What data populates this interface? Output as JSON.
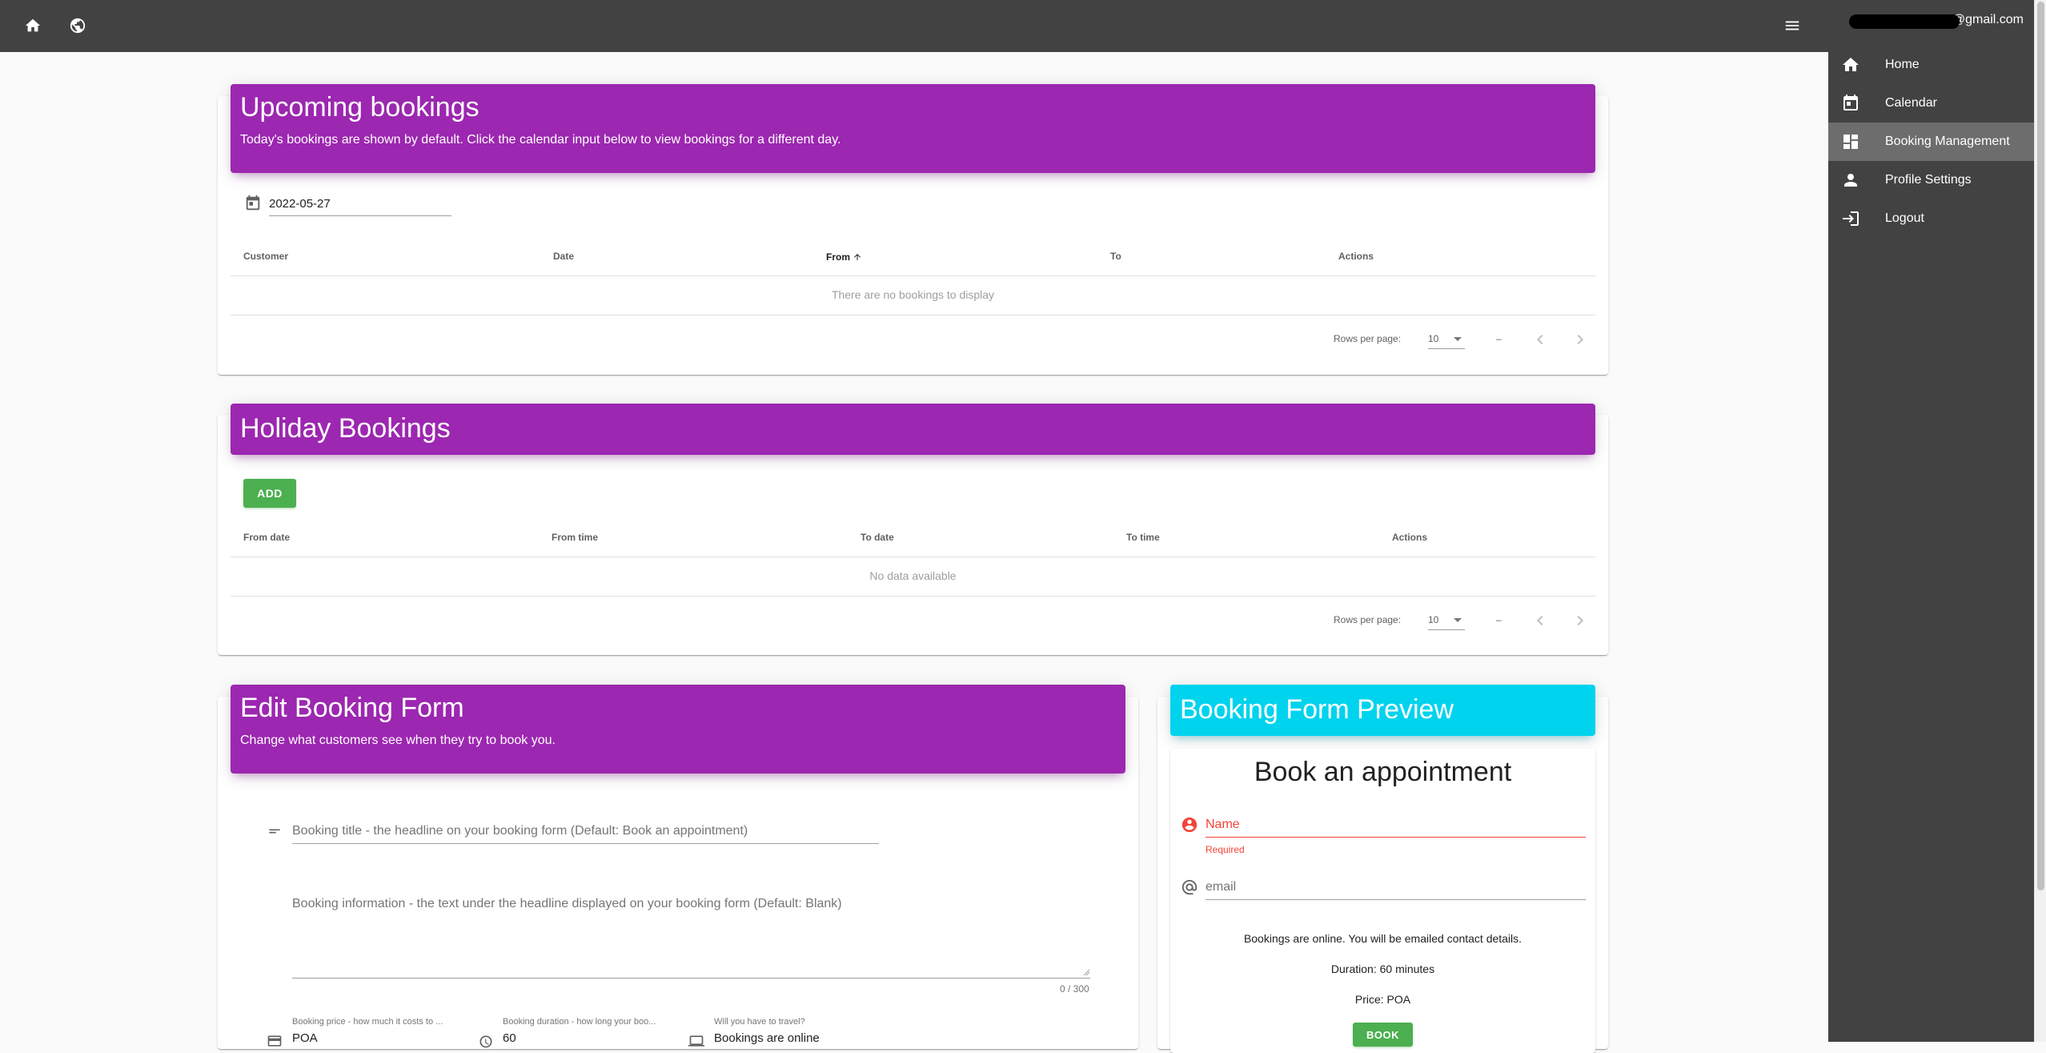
{
  "appbar": {
    "home_icon": "home-icon",
    "globe_icon": "globe-icon",
    "menu_icon": "menu-icon"
  },
  "drawer": {
    "email_suffix": "@gmail.com",
    "items": [
      {
        "label": "Home",
        "icon": "home-icon"
      },
      {
        "label": "Calendar",
        "icon": "calendar-icon"
      },
      {
        "label": "Booking Management",
        "icon": "dashboard-icon",
        "active": true
      },
      {
        "label": "Profile Settings",
        "icon": "person-icon"
      },
      {
        "label": "Logout",
        "icon": "logout-icon"
      }
    ]
  },
  "upcoming": {
    "title": "Upcoming bookings",
    "subtitle": "Today's bookings are shown by default. Click the calendar input below to view bookings for a different day.",
    "date_value": "2022-05-27",
    "columns": [
      "Customer",
      "Date",
      "From",
      "To",
      "Actions"
    ],
    "empty_text": "There are no bookings to display",
    "rows_per_page_label": "Rows per page:",
    "rows_per_page_value": "10",
    "page_range": "–"
  },
  "holiday": {
    "title": "Holiday Bookings",
    "add_label": "ADD",
    "columns": [
      "From date",
      "From time",
      "To date",
      "To time",
      "Actions"
    ],
    "empty_text": "No data available",
    "rows_per_page_label": "Rows per page:",
    "rows_per_page_value": "10",
    "page_range": "–"
  },
  "edit_form": {
    "title": "Edit Booking Form",
    "subtitle": "Change what customers see when they try to book you.",
    "title_placeholder": "Booking title - the headline on your booking form (Default: Book an appointment)",
    "info_placeholder": "Booking information - the text under the headline displayed on your booking form (Default: Blank)",
    "char_count": "0 / 300",
    "price_label": "Booking price - how much it costs to ...",
    "price_value": "POA",
    "duration_label": "Booking duration - how long your boo...",
    "duration_value": "60",
    "travel_label": "Will you have to travel?",
    "travel_value": "Bookings are online"
  },
  "preview": {
    "title": "Booking Form Preview",
    "heading": "Book an appointment",
    "name_placeholder": "Name",
    "name_error": "Required",
    "email_placeholder": "email",
    "online_text": "Bookings are online. You will be emailed contact details.",
    "duration_text": "Duration: 60 minutes",
    "price_text": "Price: POA",
    "book_label": "BOOK"
  },
  "colors": {
    "appbar": "#424242",
    "purple": "#9c27b0",
    "cyan": "#00d3ee",
    "green": "#4caf50",
    "error": "#f44336"
  }
}
